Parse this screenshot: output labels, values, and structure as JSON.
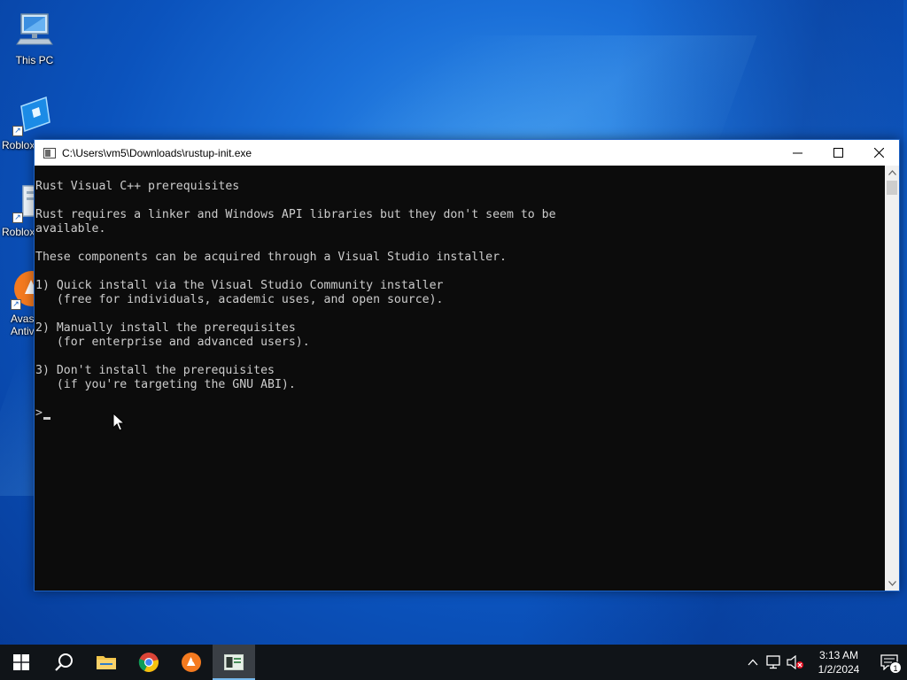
{
  "desktop": {
    "icons": [
      {
        "label": "This PC",
        "icon": "computer-icon"
      },
      {
        "label": "Roblox",
        "icon": "roblox-icon"
      },
      {
        "label": "Roblox",
        "icon": "roblox-icon"
      },
      {
        "label": "Avast Antivirus",
        "icon": "avast-icon"
      }
    ]
  },
  "window": {
    "title": "C:\\Users\\vm5\\Downloads\\rustup-init.exe",
    "minimize_label": "─",
    "maximize_label": "☐",
    "close_label": "✕",
    "console_lines": [
      "Rust Visual C++ prerequisites",
      "",
      "Rust requires a linker and Windows API libraries but they don't seem to be",
      "available.",
      "",
      "These components can be acquired through a Visual Studio installer.",
      "",
      "1) Quick install via the Visual Studio Community installer",
      "   (free for individuals, academic uses, and open source).",
      "",
      "2) Manually install the prerequisites",
      "   (for enterprise and advanced users).",
      "",
      "3) Don't install the prerequisites",
      "   (if you're targeting the GNU ABI).",
      ""
    ],
    "prompt": ">"
  },
  "taskbar": {
    "items": [
      {
        "name": "start-button",
        "icon": "windows-logo-icon"
      },
      {
        "name": "search-button",
        "icon": "search-icon"
      },
      {
        "name": "file-explorer",
        "icon": "folder-icon"
      },
      {
        "name": "chrome",
        "icon": "chrome-icon"
      },
      {
        "name": "avast",
        "icon": "avast-icon"
      },
      {
        "name": "console-window",
        "icon": "console-icon",
        "active": true
      }
    ],
    "tray": {
      "time": "3:13 AM",
      "date": "1/2/2024",
      "notification_count": "1"
    }
  },
  "colors": {
    "console_bg": "#0c0c0c",
    "console_fg": "#cccccc",
    "taskbar_bg": "#101418",
    "accent": "#76b9ed"
  }
}
